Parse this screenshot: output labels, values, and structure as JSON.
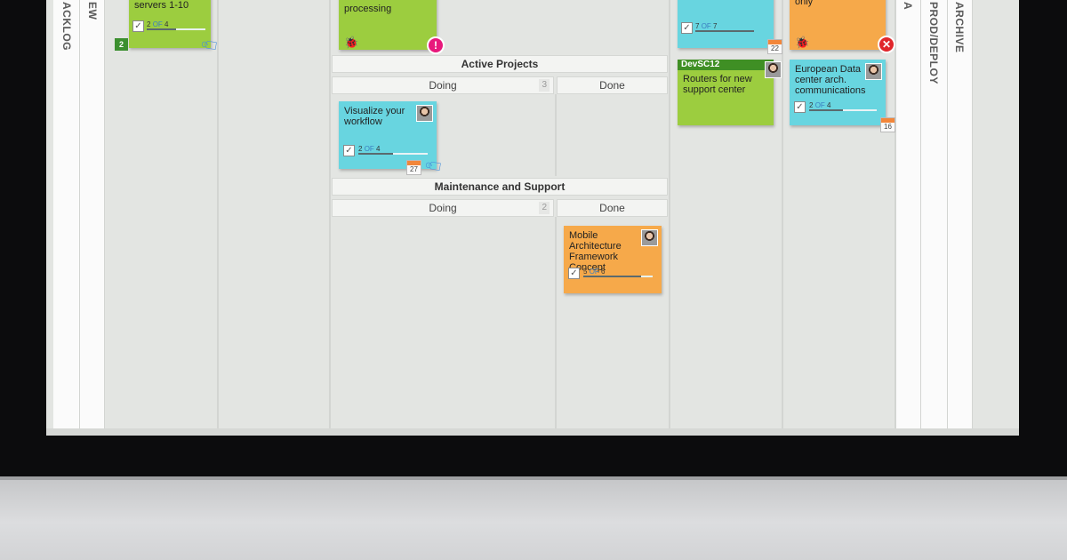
{
  "board": {
    "vertical_labels": {
      "backlog": "ACKLOG",
      "review": "EW",
      "prod_deploy": "PROD/DEPLOY",
      "archive": "ARCHIVE",
      "partial": "A"
    },
    "lanes": {
      "active_projects": {
        "title": "Active Projects",
        "doing": "Doing",
        "doing_wip": "3",
        "done": "Done"
      },
      "maintenance": {
        "title": "Maintenance and Support",
        "doing": "Doing",
        "doing_wip": "2",
        "done": "Done"
      }
    }
  },
  "cards": {
    "backlog_top": {
      "title": "servers 1-10",
      "done": "2",
      "of": "OF",
      "total": "4",
      "progress": 0.5,
      "badge": "2",
      "icon": "tag-icon"
    },
    "processing_top": {
      "title": "processing",
      "icons": [
        "bug-icon",
        "alert-exclamation-icon"
      ]
    },
    "cyan_top": {
      "done": "7",
      "of": "OF",
      "total": "7",
      "progress": 1.0,
      "due": "22"
    },
    "orange_top": {
      "title": "only",
      "icons": [
        "bug-icon",
        "blocked-icon"
      ]
    },
    "visualize": {
      "title": "Visualize your workflow",
      "done": "2",
      "of": "OF",
      "total": "4",
      "progress": 0.5,
      "due": "27",
      "icon": "tag-icon"
    },
    "devsc12": {
      "header": "DevSC12",
      "title": "Routers for new support center"
    },
    "european": {
      "title": "European Data center arch. communications",
      "done": "2",
      "of": "OF",
      "total": "4",
      "progress": 0.5,
      "due": "16"
    },
    "mobile": {
      "title": "Mobile Architecture Framework Concept",
      "done": "5",
      "of": "OF",
      "total": "6",
      "progress": 0.83
    }
  },
  "colors": {
    "green": "#9ccd3f",
    "cyan": "#68d5e0",
    "orange": "#f6a94a",
    "alert": "#e8197c",
    "blocked": "#e0262b"
  }
}
